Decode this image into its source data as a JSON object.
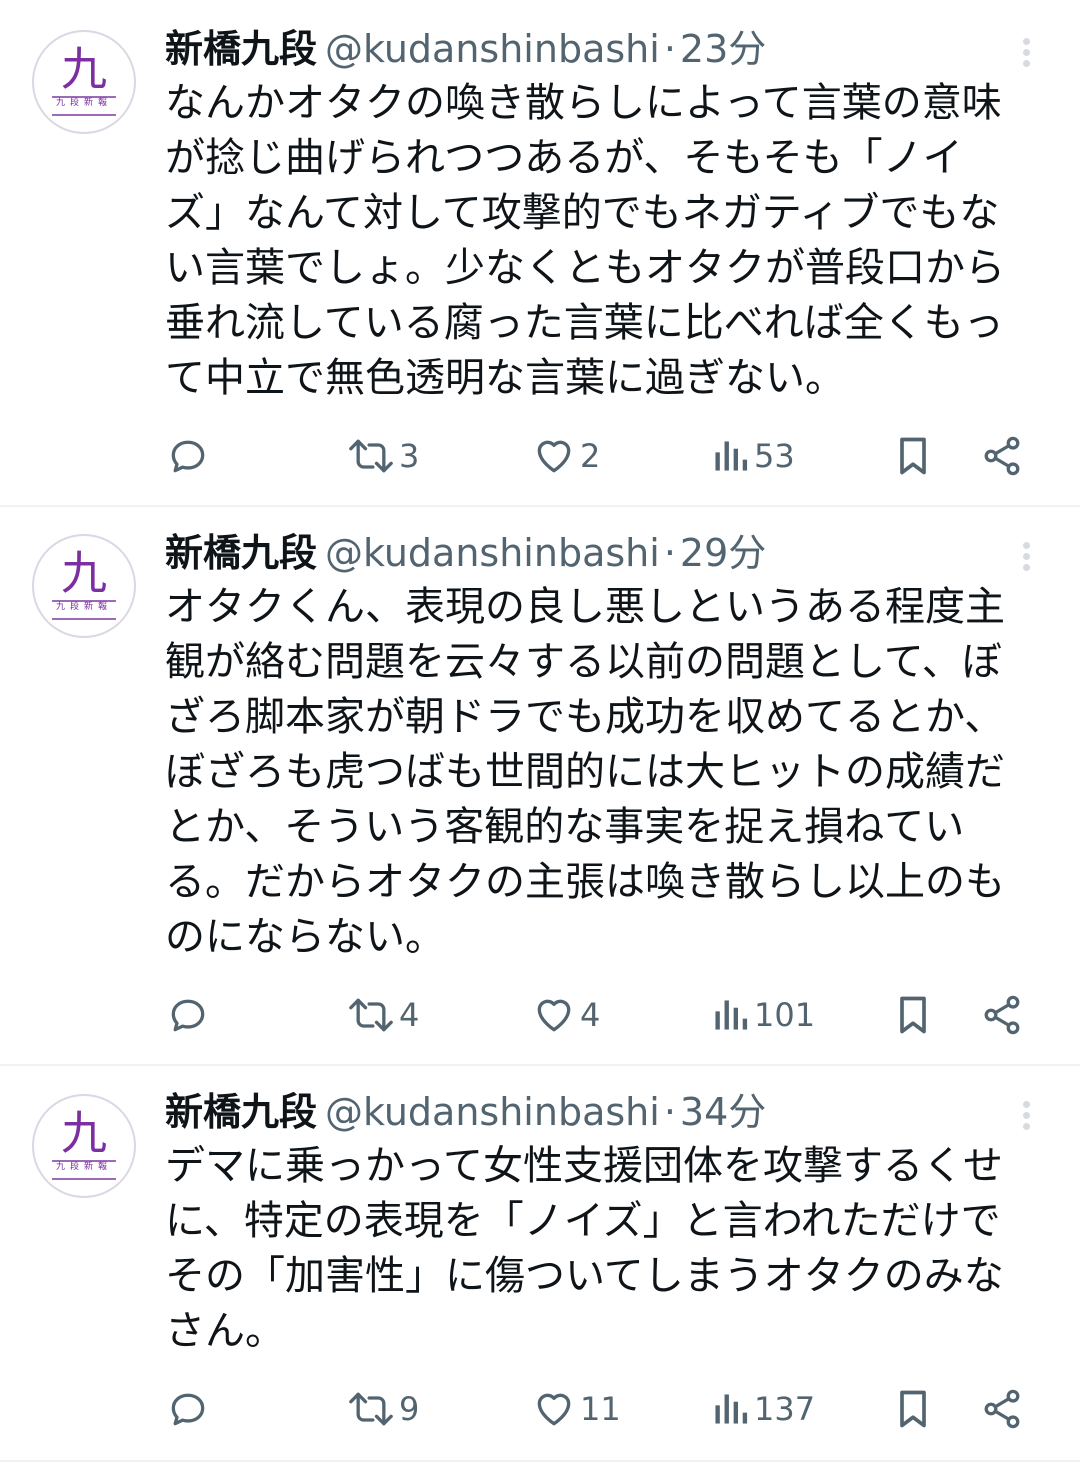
{
  "tweets": [
    {
      "display_name": "新橋九段",
      "handle": "@kudanshinbashi",
      "separator": "·",
      "time": "23分",
      "text": "なんかオタクの喚き散らしによって言葉の意味\nが捻じ曲げられつつあるが、そもそも「ノイ\nズ」なんて対して攻撃的でもネガティブでもな\nい言葉でしょ。少なくともオタクが普段口から\n垂れ流している腐った言葉に比べれば全くもっ\nて中立で無色透明な言葉に過ぎない。",
      "retweets": "3",
      "likes": "2",
      "views": "53"
    },
    {
      "display_name": "新橋九段",
      "handle": "@kudanshinbashi",
      "separator": "·",
      "time": "29分",
      "text": "オタクくん、表現の良し悪しというある程度主\n観が絡む問題を云々する以前の問題として、ぼ\nざろ脚本家が朝ドラでも成功を収めてるとか、\nぼざろも虎つばも世間的には大ヒットの成績だ\nとか、そういう客観的な事実を捉え損ねてい\nる。だからオタクの主張は喚き散らし以上のも\nのにならない。",
      "retweets": "4",
      "likes": "4",
      "views": "101"
    },
    {
      "display_name": "新橋九段",
      "handle": "@kudanshinbashi",
      "separator": "·",
      "time": "34分",
      "text": "デマに乗っかって女性支援団体を攻撃するくせ\nに、特定の表現を「ノイズ」と言われただけで\nその「加害性」に傷ついてしまうオタクのみな\nさん。",
      "retweets": "9",
      "likes": "11",
      "views": "137"
    }
  ],
  "avatar": {
    "glyph": "九",
    "caption": "九段新報"
  },
  "icons": {
    "reply": "reply-icon",
    "retweet": "retweet-icon",
    "like": "heart-icon",
    "views": "views-icon",
    "bookmark": "bookmark-icon",
    "share": "share-icon",
    "more": "more-icon"
  },
  "colors": {
    "text": "#0f1419",
    "secondary": "#536471",
    "divider": "#eff3f4",
    "avatar_accent": "#7b2fa0"
  }
}
